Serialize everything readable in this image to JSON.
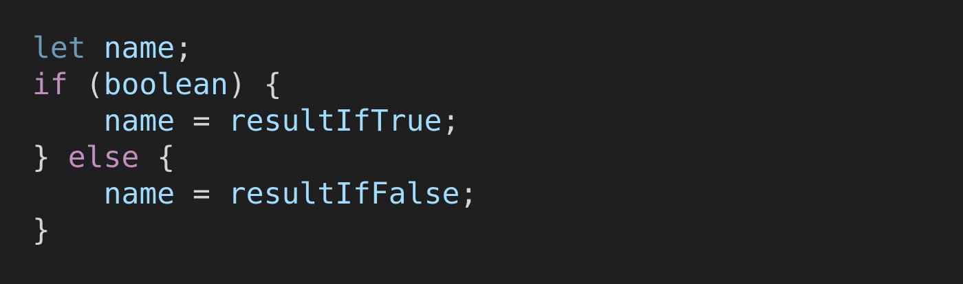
{
  "editor": {
    "background": "#1f1f1f",
    "colors": {
      "keyword_declaration": "#6a9ab5",
      "keyword_control": "#c08fc0",
      "identifier": "#9fdcfe",
      "punctuation": "#d4d4d4"
    },
    "lines": [
      {
        "indent": "",
        "tokens": [
          "let",
          " ",
          "name",
          ";"
        ]
      },
      {
        "indent": "",
        "tokens": [
          "if",
          " (",
          "boolean",
          ") {"
        ]
      },
      {
        "indent": "    ",
        "tokens": [
          "name",
          " = ",
          "resultIfTrue",
          ";"
        ]
      },
      {
        "indent": "",
        "tokens": [
          "}",
          " ",
          "else",
          " {"
        ]
      },
      {
        "indent": "    ",
        "tokens": [
          "name",
          " = ",
          "resultIfFalse",
          ";"
        ]
      },
      {
        "indent": "",
        "tokens": [
          "}"
        ]
      }
    ]
  }
}
